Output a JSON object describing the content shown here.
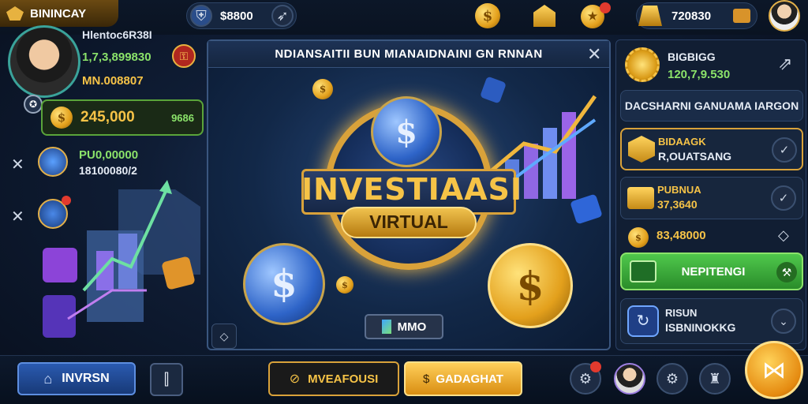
{
  "top_bar": {
    "title": "BININCAY",
    "currency_value": "$8800",
    "wallet_value": "720830"
  },
  "profile": {
    "name": "Hlentoc6R38I",
    "line1": "1,7,3,899830",
    "line2": "MN.008807",
    "balance": "245,000",
    "balance_badge": "9686"
  },
  "left_list": [
    {
      "value": "PU0,00000",
      "sub": "18100080/2"
    }
  ],
  "main_panel": {
    "header": "NDIANSAITII BUN  MIANAIDNAINI GN RNNAN",
    "title_line1": "INVESTIAASI",
    "title_line2": "VIRTUAL",
    "button_label": "MMO"
  },
  "right_panel": {
    "top_label": "BIGBIGG",
    "top_value": "120,7,9.530",
    "banner": "DACSHARNI GANUAMA IARGON",
    "items": [
      {
        "title": "BIDAAGK",
        "sub": "R,OUATSANG"
      },
      {
        "title": "PUBNUA",
        "sub": "37,3640"
      },
      {
        "title": "",
        "sub": "83,48000"
      }
    ],
    "green_button": "NEPITENGI",
    "bottom_title": "RISUN",
    "bottom_sub": "ISBNINOKKG"
  },
  "bottom_bar": {
    "home_label": "INVRSN",
    "mid_dark": "MVEAFOUSI",
    "mid_gold": "GADAGHAT"
  },
  "colors": {
    "gold": "#f6c347",
    "green": "#4bb84a",
    "panel": "#16263f",
    "accent_blue": "#2e64c8"
  }
}
